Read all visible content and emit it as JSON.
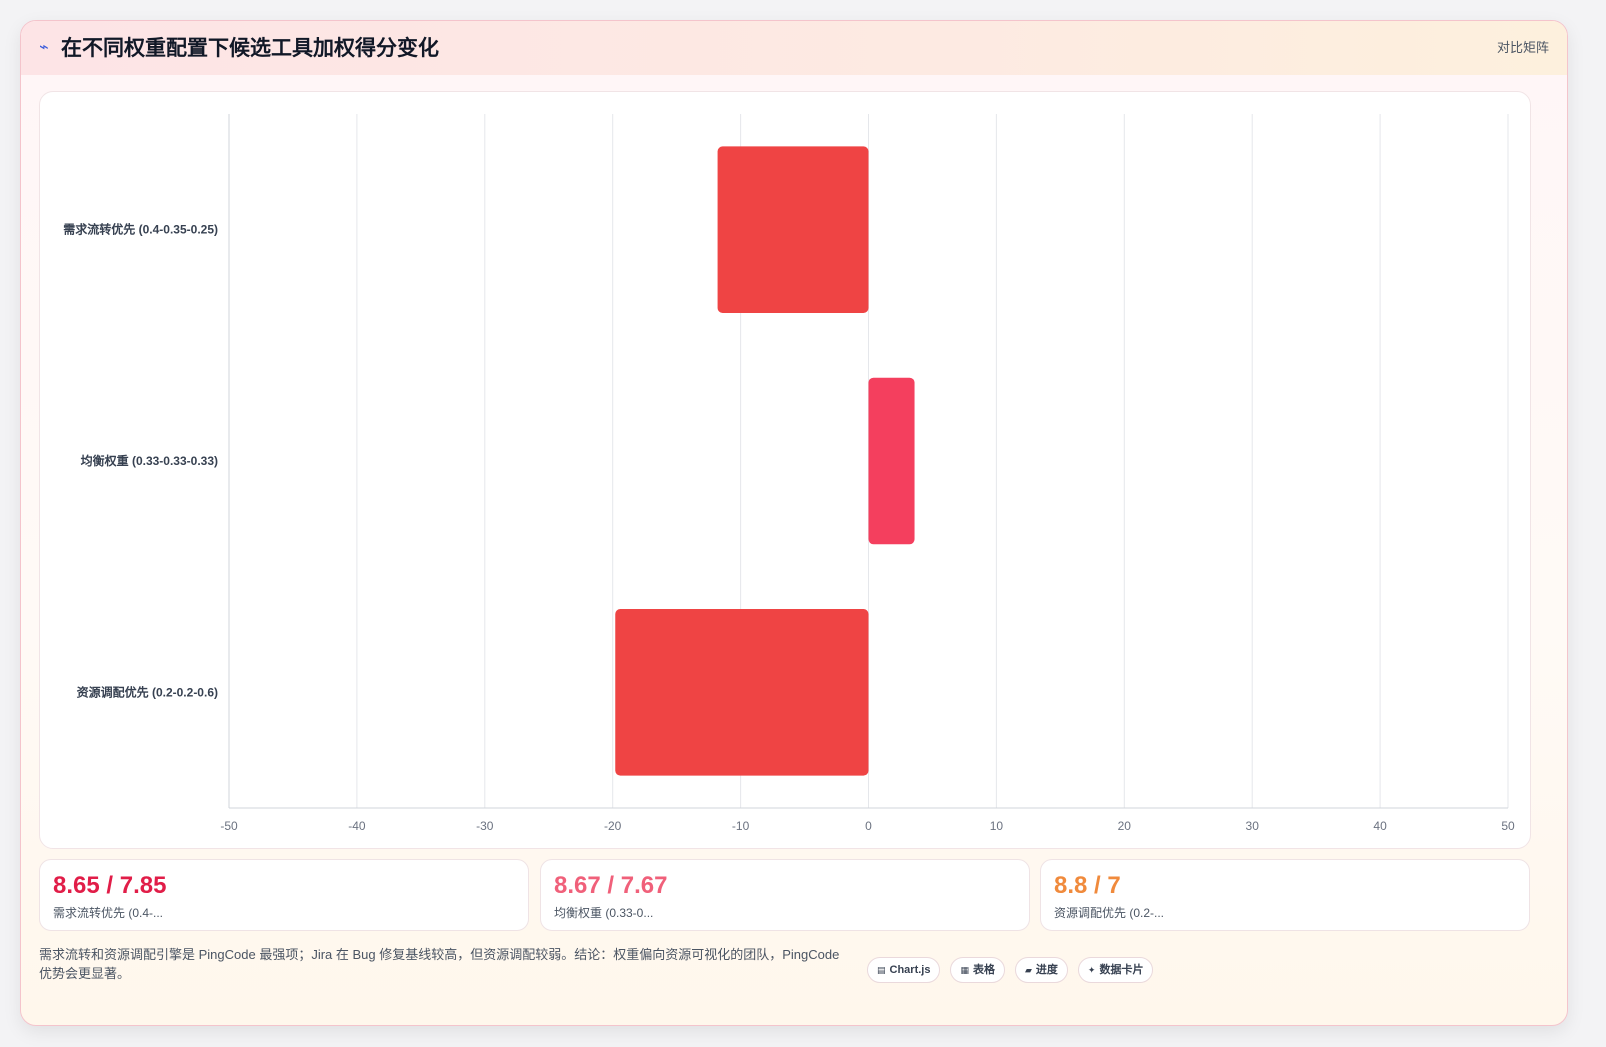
{
  "header": {
    "icon": "lightning-icon",
    "title": "在不同权重配置下候选工具加权得分变化",
    "tag": "对比矩阵"
  },
  "chart_data": {
    "type": "bar",
    "orientation": "horizontal",
    "categories": [
      "需求流转优先 (0.4-0.35-0.25)",
      "均衡权重 (0.33-0.33-0.33)",
      "资源调配优先 (0.2-0.2-0.6)"
    ],
    "values": [
      -11.8,
      3.6,
      -19.8
    ],
    "bar_colors": [
      "#ef4444",
      "#f43f5e",
      "#ef4444"
    ],
    "xlim": [
      -50,
      50
    ],
    "xticks": [
      "-50",
      "-40",
      "-30",
      "-20",
      "-10",
      "0",
      "10",
      "20",
      "30",
      "40",
      "50"
    ],
    "xtick_values": [
      -50,
      -40,
      -30,
      -20,
      -10,
      0,
      10,
      20,
      30,
      40,
      50
    ],
    "grid": true,
    "legend": "none"
  },
  "stats": [
    {
      "value": "8.65 / 7.85",
      "label": "需求流转优先 (0.4-...",
      "color": "#e11d48"
    },
    {
      "value": "8.67 / 7.67",
      "label": "均衡权重 (0.33-0...",
      "color": "#f0607a"
    },
    {
      "value": "8.8 / 7",
      "label": "资源调配优先 (0.2-...",
      "color": "#f08a3c"
    }
  ],
  "footer": {
    "text": "需求流转和资源调配引擎是 PingCode 最强项；Jira 在 Bug 修复基线较高，但资源调配较弱。结论：权重偏向资源可视化的团队，PingCode 优势会更显著。",
    "chips": [
      {
        "icon": "chart-icon",
        "glyph": "▤",
        "label": "Chart.js"
      },
      {
        "icon": "table-icon",
        "glyph": "▦",
        "label": "表格"
      },
      {
        "icon": "progress-icon",
        "glyph": "▰",
        "label": "进度"
      },
      {
        "icon": "data-card-icon",
        "glyph": "✦",
        "label": "数据卡片"
      }
    ]
  }
}
